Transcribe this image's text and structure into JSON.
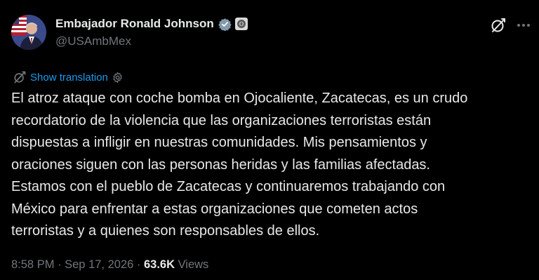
{
  "author": {
    "display_name": "Embajador Ronald Johnson",
    "handle": "@USAmbMex",
    "verified_badge_color": "#829aab",
    "avatar_icon": "avatar-portrait-with-us-flag"
  },
  "header_actions": {
    "grok_icon": "grok-icon",
    "more_icon": "more-options-icon"
  },
  "translation": {
    "label": "Show translation",
    "link_color": "#1d9bf0"
  },
  "tweet": {
    "text": "El atroz ataque con coche bomba en Ojocaliente, Zacatecas, es un crudo\nrecordatorio de la violencia que las organizaciones terroristas están\ndispuestas a infligir en nuestras comunidades. Mis pensamientos y\noraciones siguen con las personas heridas y las familias afectadas.\nEstamos con el pueblo de Zacatecas y continuaremos trabajando con\nMéxico para enfrentar a estas organizaciones que cometen actos\nterroristas y a quienes son responsables de ellos."
  },
  "meta": {
    "time": "8:58 PM",
    "separator": " · ",
    "date": "Sep 17, 2026",
    "views_count": "63.6K",
    "views_label": " Views"
  },
  "colors": {
    "background": "#000000",
    "primary_text": "#e7e9ea",
    "secondary_text": "#71767b"
  }
}
